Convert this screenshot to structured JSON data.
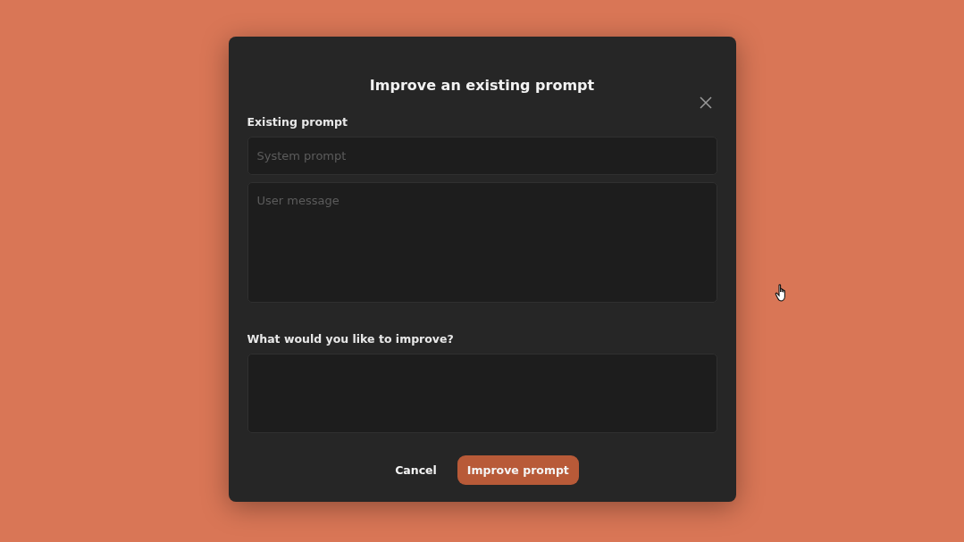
{
  "dialog": {
    "title": "Improve an existing prompt",
    "sections": [
      {
        "label": "Existing prompt",
        "fields": [
          {
            "placeholder": "System prompt",
            "kind": "line"
          },
          {
            "placeholder": "User message",
            "kind": "area"
          }
        ]
      },
      {
        "label": "What would you like to improve?",
        "fields": [
          {
            "kind": "area"
          }
        ]
      }
    ],
    "buttons": [
      {
        "label": "Cancel",
        "kind": "plain"
      },
      {
        "label": "Improve prompt",
        "kind": "primary"
      }
    ]
  }
}
